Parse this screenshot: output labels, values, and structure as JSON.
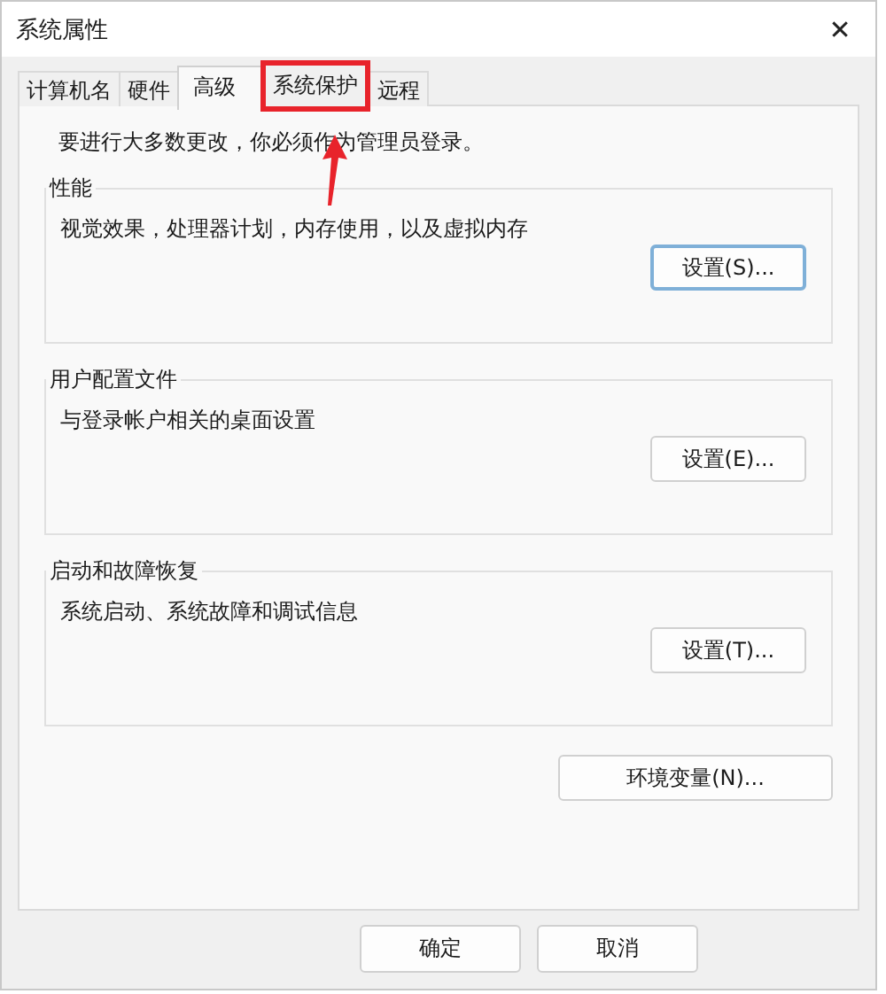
{
  "window": {
    "title": "系统属性",
    "close": "✕"
  },
  "tabs": [
    {
      "label": "计算机名",
      "selected": false,
      "highlighted": false
    },
    {
      "label": "硬件",
      "selected": false,
      "highlighted": false
    },
    {
      "label": "高级",
      "selected": true,
      "highlighted": false
    },
    {
      "label": "系统保护",
      "selected": false,
      "highlighted": true
    },
    {
      "label": "远程",
      "selected": false,
      "highlighted": false
    }
  ],
  "notice": "要进行大多数更改，你必须作为管理员登录。",
  "groups": [
    {
      "title": "性能",
      "description": "视觉效果，处理器计划，内存使用，以及虚拟内存",
      "button": "设置(S)...",
      "focused": true
    },
    {
      "title": "用户配置文件",
      "description": "与登录帐户相关的桌面设置",
      "button": "设置(E)...",
      "focused": false
    },
    {
      "title": "启动和故障恢复",
      "description": "系统启动、系统故障和调试信息",
      "button": "设置(T)...",
      "focused": false
    }
  ],
  "env_button": "环境变量(N)...",
  "buttons": [
    "确定",
    "取消"
  ]
}
